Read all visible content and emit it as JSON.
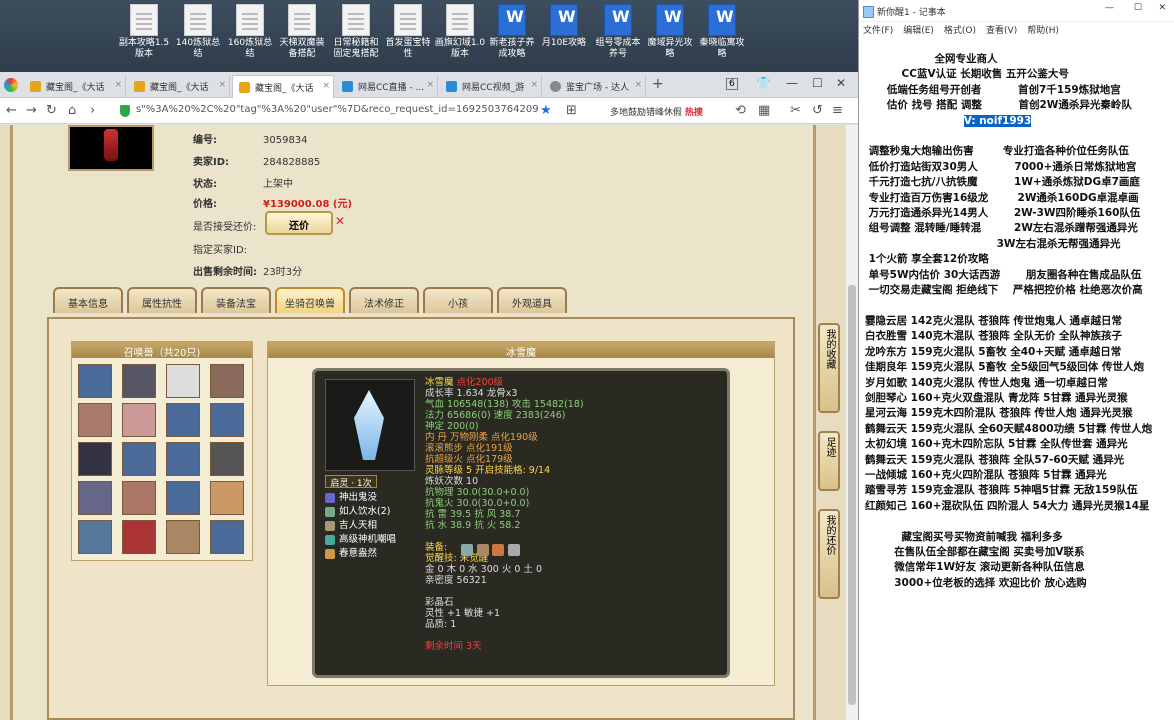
{
  "desktop": {
    "icons": [
      {
        "label": "副本攻略1.5版本",
        "type": "doc"
      },
      {
        "label": "140炼狱总结",
        "type": "doc"
      },
      {
        "label": "160炼狱总结",
        "type": "doc"
      },
      {
        "label": "天梯双魔装备搭配",
        "type": "doc"
      },
      {
        "label": "日常秘籍和固定鬼搭配",
        "type": "doc"
      },
      {
        "label": "首发蛋宝特性",
        "type": "doc"
      },
      {
        "label": "画旗幻域1.0版本",
        "type": "doc"
      },
      {
        "label": "新老孩子养成攻略",
        "type": "word"
      },
      {
        "label": "月10E攻略",
        "type": "word"
      },
      {
        "label": "组号零成本养号",
        "type": "word"
      },
      {
        "label": "魔域异光攻略",
        "type": "word"
      },
      {
        "label": "秦晓临寓攻略",
        "type": "word"
      }
    ]
  },
  "browser": {
    "tabs": [
      "藏宝阁_《大话",
      "藏宝阁_《大话",
      "藏宝阁_《大话",
      "网易CC直播 - ...",
      "网易CC视频_游",
      "鉴宝广场 - 达人"
    ],
    "tab_count": "6",
    "url": "s\"%3A%20%2C%20\"tag\"%3A%20\"user\"%7D&reco_request_id=1692503764209Z1hi",
    "search": "多地鼓励错峰休假",
    "hot": "热搜"
  },
  "listing": {
    "id_label": "编号:",
    "id": "3059834",
    "seller_label": "卖家ID:",
    "seller": "284828885",
    "status_label": "状态:",
    "status": "上架中",
    "price_label": "价格:",
    "price": "¥139000.08 (元)",
    "counter_label": "是否接受还价:",
    "counter_button": "还价",
    "buyer_label": "指定买家ID:",
    "remaining_label": "出售剩余时间:",
    "remaining": "23时3分"
  },
  "game_tabs": [
    "基本信息",
    "属性抗性",
    "装备法宝",
    "坐骑召唤兽",
    "法术修正",
    "小孩",
    "外观道具"
  ],
  "pets": {
    "title": "召唤兽（共20只)",
    "count": 20
  },
  "detail": {
    "title": "冰雪魔",
    "lines": [
      {
        "t": "冰雪魔",
        "c": "c-y",
        "extra": "点化200级",
        "ec": "c-r"
      },
      {
        "t": "成长率 1.634  龙骨x3",
        "c": ""
      },
      {
        "t": "气血 106548(138) 攻击 15482(18)",
        "c": "c-g"
      },
      {
        "t": "法力 65686(0) 速度 2383(246)",
        "c": "c-g"
      },
      {
        "t": "神定 200(0)",
        "c": "c-g"
      },
      {
        "t": "内  丹  万物刚柔 点化190级",
        "c": "c-o"
      },
      {
        "t": "          滚滚熊步 点化191级",
        "c": "c-o"
      },
      {
        "t": "          抗超级火 点化179级",
        "c": "c-o"
      },
      {
        "t": "灵脉等级  5  开启技能格: 9/14",
        "c": "c-y"
      },
      {
        "t": "炼妖次数 10",
        "c": ""
      },
      {
        "t": "抗物理 30.0(30.0+0.0)",
        "c": "c-g"
      },
      {
        "t": "抗鬼火 30.0(30.0+0.0)",
        "c": "c-g"
      },
      {
        "t": "抗  雷  39.5 抗  风  38.7",
        "c": "c-g"
      },
      {
        "t": "抗  水  38.9 抗  火  58.2",
        "c": "c-g"
      },
      {
        "t": "",
        "c": ""
      },
      {
        "t": "装备:",
        "c": "c-y"
      },
      {
        "t": "觉醒技:  未觉醒",
        "c": "c-y"
      },
      {
        "t": "金 0 木 0 水 300 火 0 土 0",
        "c": ""
      },
      {
        "t": "亲密度 56321",
        "c": ""
      },
      {
        "t": "",
        "c": ""
      },
      {
        "t": "彩晶石",
        "c": ""
      },
      {
        "t": "灵性 +1 敏捷 +1",
        "c": ""
      },
      {
        "t": "品质: 1",
        "c": ""
      },
      {
        "t": "",
        "c": ""
      },
      {
        "t": "剩余时间  3天",
        "c": "c-r"
      }
    ],
    "badge": "启灵 · 1次",
    "skills": [
      "神出鬼没",
      "如人饮水(2)",
      "吉人天相",
      "高级神机嘲唱",
      "春意盎然"
    ]
  },
  "side_buttons": [
    "我的收藏",
    "足迹",
    "我的还价"
  ],
  "notepad": {
    "title": "新你醒1 - 记事本",
    "menu": [
      "文件(F)",
      "编辑(E)",
      "格式(O)",
      "查看(V)",
      "帮助(H)"
    ],
    "lines": [
      "                   全网专业商人",
      "          CC蓝V认证 长期收售 五开公鉴大号",
      "      低端任务组号开创者          首创7千159炼狱地宫",
      "      估价 找号 搭配 调整          首创2W通杀异光秦岭队",
      "                           V: noif1993",
      "",
      " 调整秒鬼大炮输出伤害        专业打造各种价位任务队伍",
      " 低价打造站街双30男人          7000+通杀日常炼狱地宫",
      " 千元打造七抗/八抗铁魔          1W+通杀炼狱DG卓7画庭",
      " 专业打造百万伤害16级龙        2W通杀160DG卓混卓画",
      " 万元打造通杀异光14男人       2W-3W四阶睡杀160队伍",
      " 组号调整 混转睡/睡转混         2W左右混杀蹭帮强通异光",
      "                                    3W左右混杀无帮强通异光",
      " 1个火箭 享全套12价攻略",
      " 单号5W内估价 30大话西游       朋友圈各种在售成品队伍",
      " 一切交易走藏宝阁 拒绝线下    严格把控价格 杜绝恶次价高",
      "",
      "霎隐云居 142克火混队 苍狼阵 传世炮鬼人 通卓越日常",
      "白衣胜雪 140克木混队 苍狼阵 全队无价 全队神族孩子",
      "龙吟东方 159克火混队 5畜牧 全40+天赋 通卓越日常",
      "佳期良年 159克火混队 5畜牧 全5级回气5级回体 传世人炮",
      "岁月如歌 140克火混队 传世人炮鬼 通一切卓越日常",
      "剑胆琴心 160+克火双盘混队 青龙阵 5甘霖 通异光灵猴",
      "星河云海 159克木四阶混队 苍狼阵 传世人炮 通异光灵猴",
      "鹤舞云天 159克火混队 全60天赋4800功绩 5甘霖 传世人炮",
      "太初幻境 160+克木四阶忘队 5甘霖 全队传世套 通异光",
      "鹤舞云天 159克火混队 苍狼阵 全队57-60天赋 通异光",
      "一战倾城 160+克火四阶混队 苍狼阵 5甘霖 通异光",
      "踏雪寻芳 159克金混队 苍狼阵 5神唱5甘霖 无敌159队伍",
      "红颜知己 160+混砍队伍 四阶混人 54大力 通异光灵猴14星",
      "",
      "          藏宝阁买号买物资前喊我 福利多多",
      "        在售队伍全部都在藏宝阁 买卖号加V联系",
      "        微信常年1W好友 滚动更新各种队伍信息",
      "        3000+位老板的选择 欢迎比价 放心选购"
    ],
    "selected_line": 4,
    "selected_text": "V: noif1993"
  }
}
